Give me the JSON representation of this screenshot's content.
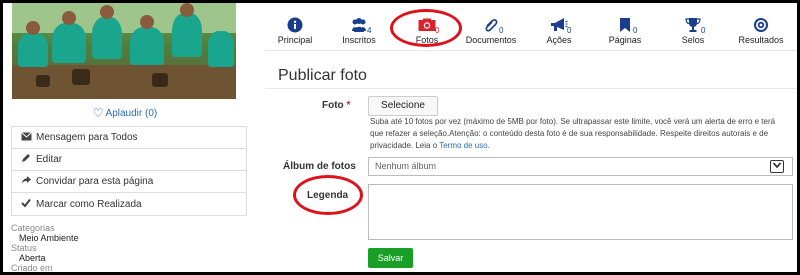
{
  "sidebar": {
    "like_label": "Aplaudir (0)",
    "actions": [
      {
        "label": "Mensagem para Todos",
        "icon": "envelope-icon"
      },
      {
        "label": "Editar",
        "icon": "pencil-icon"
      },
      {
        "label": "Convidar para esta página",
        "icon": "share-arrow-icon"
      },
      {
        "label": "Marcar como Realizada",
        "icon": "checkmark-icon"
      }
    ],
    "meta": {
      "categorias_label": "Categorias",
      "categorias_value": "Meio Ambiente",
      "status_label": "Status",
      "status_value": "Aberta",
      "criado_label": "Criado em"
    }
  },
  "tabs": [
    {
      "label": "Principal",
      "count": "",
      "icon": "info-icon"
    },
    {
      "label": "Inscritos",
      "count": "4",
      "icon": "users-icon"
    },
    {
      "label": "Fotos",
      "count": "0",
      "icon": "camera-icon"
    },
    {
      "label": "Documentos",
      "count": "0",
      "icon": "paperclip-icon"
    },
    {
      "label": "Ações",
      "count": "0",
      "icon": "megaphone-icon"
    },
    {
      "label": "Páginas",
      "count": "0",
      "icon": "bookmark-icon"
    },
    {
      "label": "Selos",
      "count": "0",
      "icon": "trophy-icon"
    },
    {
      "label": "Resultados",
      "count": "",
      "icon": "target-icon"
    }
  ],
  "form": {
    "title": "Publicar foto",
    "foto_label": "Foto",
    "required_mark": "*",
    "select_button": "Selecione",
    "help_text": "Suba até 10 fotos por vez (máximo de 5MB por foto). Se ultrapassar este limite, você verá um alerta de erro e terá que refazer a seleção.Atenção: o conteúdo desta foto é de sua responsabilidade. Respeite direitos autorais e de privacidade. Leia o",
    "help_link": "Termo de uso",
    "help_end": ".",
    "album_label": "Álbum de fotos",
    "album_value": "Nenhum álbum",
    "legenda_label": "Legenda",
    "legenda_value": "",
    "save_button": "Salvar"
  },
  "colors": {
    "nav_icon": "#1a3e8c",
    "camera_icon": "#d9232d",
    "highlight_circle": "#e0101a",
    "save_button": "#18a026",
    "link": "#2b6cb0"
  }
}
